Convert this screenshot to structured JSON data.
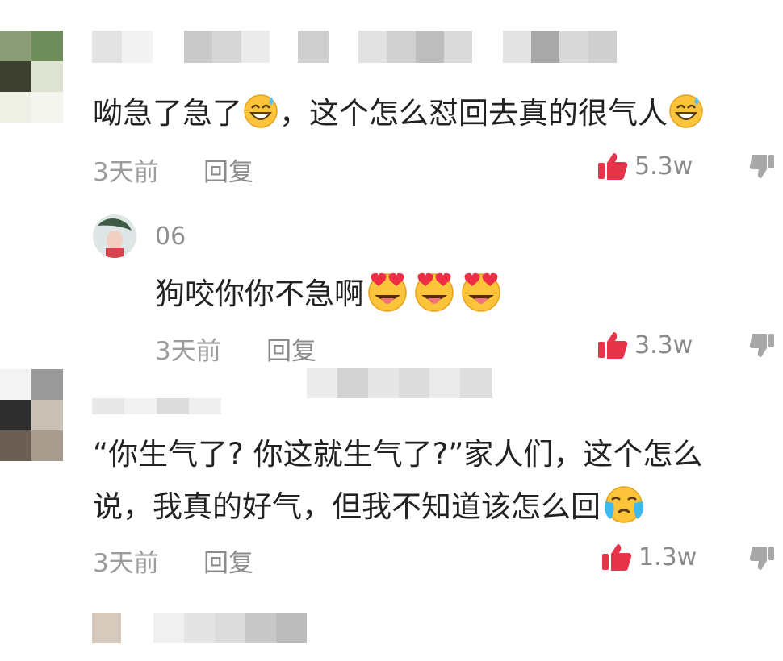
{
  "comments": [
    {
      "text_a": "呦急了急了",
      "text_b": "，这个怎么怼回去真的很气人",
      "time": "3天前",
      "reply_label": "回复",
      "likes": "5.3w"
    },
    {
      "username": "06",
      "text": "狗咬你你不急啊",
      "time": "3天前",
      "reply_label": "回复",
      "likes": "3.3w"
    },
    {
      "line1": "“你生气了? 你这就生气了?”家人们，这个怎么",
      "line2": "说，我真的好气，但我不知道该怎么回",
      "time": "3天前",
      "reply_label": "回复",
      "likes": "1.3w"
    }
  ],
  "colors": {
    "like_icon": "#e8344a",
    "meta_text": "#9c9c9c",
    "body_text": "#222222"
  },
  "icons": [
    "grin-sweat-emoji",
    "heart-eyes-tongue-emoji",
    "crying-emoji",
    "thumbs-up-icon",
    "thumbs-down-icon"
  ]
}
